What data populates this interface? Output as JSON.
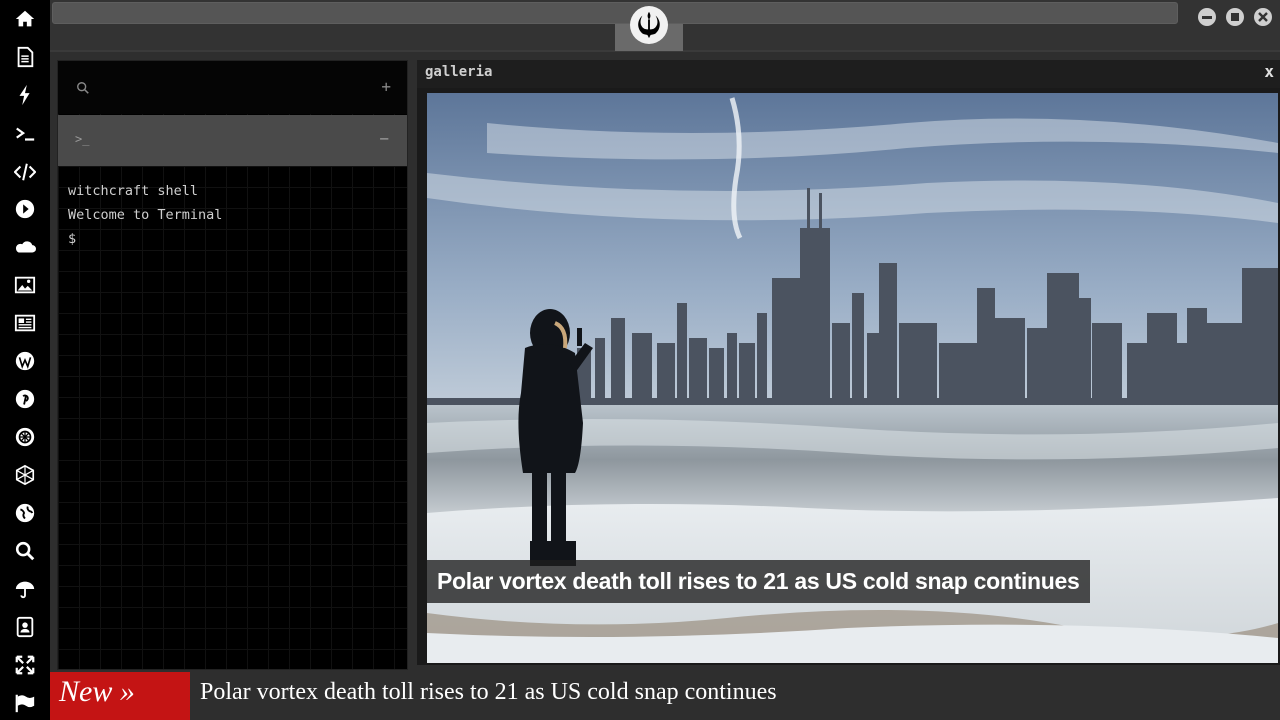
{
  "sidebar": {
    "icons": [
      "home-icon",
      "document-icon",
      "bolt-icon",
      "terminal-icon",
      "code-icon",
      "play-icon",
      "cloud-icon",
      "image-icon",
      "newspaper-icon",
      "wordpress-icon",
      "pinterest-icon",
      "rebel-alliance-icon",
      "sphere-icon",
      "globe-icon",
      "search-icon",
      "umbrella-icon",
      "contact-book-icon",
      "expand-icon",
      "flag-icon"
    ]
  },
  "window": {
    "controls": [
      "minimize",
      "maximize",
      "close"
    ]
  },
  "terminal": {
    "add_label": "+",
    "tab_prompt": ">_",
    "collapse_label": "−",
    "lines": [
      "witchcraft shell",
      "Welcome to Terminal",
      "$"
    ]
  },
  "galleria": {
    "title": "galleria",
    "close_label": "x",
    "caption": "Polar vortex death toll rises to 21 as US cold snap continues"
  },
  "ticker": {
    "badge": "New »",
    "headline": "Polar vortex death toll rises to 21 as US cold snap continues"
  },
  "colors": {
    "sidebar_bg": "#000000",
    "ticker_badge": "#c41414",
    "panel_bg": "#2e2e2e"
  }
}
